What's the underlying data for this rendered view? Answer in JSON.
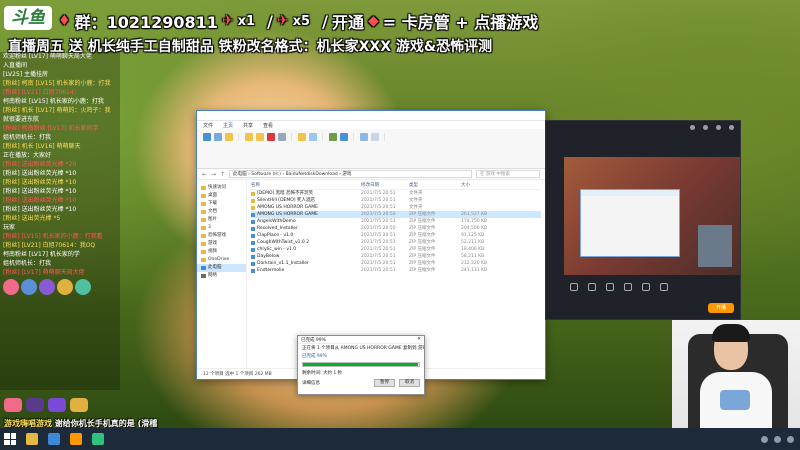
{
  "overlay": {
    "logo": "斗鱼",
    "qq_group_label": "群：1021290811",
    "gift_count_1": "x1",
    "gift_count_2": "x5",
    "open_label": "开通",
    "open_reward": "= 卡房管 + 点播游戏",
    "line2": "直播周五 送  机长纯手工自制甜品    铁粉改名格式：机长家XXX  游戏&恐怖评测"
  },
  "chat": {
    "lines": [
      {
        "text": "欢迎粉丝 [LV17] 萌萌聊天局大佬",
        "style": ""
      },
      {
        "text": "入直播间",
        "style": ""
      },
      {
        "text": "[LV25] 主播挂房",
        "style": ""
      },
      {
        "text": "[粉丝] 柯南 [LV15] 机长家的小鹿：打我",
        "style": "y"
      },
      {
        "text": "[粉丝] [LV21] 白旭70614：",
        "style": "r"
      },
      {
        "text": "柯南粉丝 [LV15] 机长家的小鹿：打我",
        "style": ""
      },
      {
        "text": "[粉丝] 机长 [LV17] 萌萌的：火鸡子：我",
        "style": "y"
      },
      {
        "text": "就很要进东航",
        "style": ""
      },
      {
        "text": "[粉丝] 柯南粉丝 [LV17] 机长家的学",
        "style": "r"
      },
      {
        "text": "姐机师机长：打我",
        "style": ""
      },
      {
        "text": "[粉丝] 机长 [LV16] 萌萌聊天",
        "style": "y"
      },
      {
        "text": "正在播放：大家好",
        "style": ""
      },
      {
        "text": "[粉丝] 送出粉丝荧光棒 *20",
        "style": "r"
      },
      {
        "text": "[粉丝] 送出粉丝荧光棒 *10",
        "style": ""
      },
      {
        "text": "[粉丝] 送出粉丝荧光棒 *10",
        "style": "y"
      },
      {
        "text": "[粉丝] 送出粉丝荧光棒 *10",
        "style": ""
      },
      {
        "text": "[粉丝] 送出粉丝荧光棒 *10",
        "style": "r"
      },
      {
        "text": "[粉丝] 送出粉丝荧光棒 *10",
        "style": ""
      },
      {
        "text": "[粉丝] 送出荧光棒 *5",
        "style": "y"
      },
      {
        "text": "玩家",
        "style": ""
      },
      {
        "text": "[粉丝] [LV15] 机长家的小鹿：打我看",
        "style": "r"
      },
      {
        "text": "[粉丝] [LV21] 白旭70614：我OQ",
        "style": "y"
      },
      {
        "text": "柯南粉丝 [LV17] 机长家的学",
        "style": ""
      },
      {
        "text": "姐机师机长：打我",
        "style": ""
      },
      {
        "text": "[粉丝] [LV17] 萌萌聊天局大佬",
        "style": "r"
      }
    ]
  },
  "explorer": {
    "title": "",
    "tabs": [
      "文件",
      "主页",
      "共享",
      "查看"
    ],
    "address": "此电脑 › Software (H:) › BaiduNetdiskDownload › 游戏",
    "search_placeholder": "在 游戏 中搜索",
    "nav_items": [
      {
        "label": "快速访问",
        "kind": "folder"
      },
      {
        "label": "桌面",
        "kind": "folder"
      },
      {
        "label": "下载",
        "kind": "folder"
      },
      {
        "label": "文档",
        "kind": "folder"
      },
      {
        "label": "图片",
        "kind": "folder"
      },
      {
        "label": "3",
        "kind": "folder"
      },
      {
        "label": "恐怖游戏",
        "kind": "folder"
      },
      {
        "label": "游戏",
        "kind": "folder"
      },
      {
        "label": "视频",
        "kind": "folder"
      },
      {
        "label": "OneDrive",
        "kind": "folder"
      },
      {
        "label": "此电脑",
        "kind": "pc"
      },
      {
        "label": "网络",
        "kind": "net"
      }
    ],
    "columns": [
      "名称",
      "修改日期",
      "类型",
      "大小"
    ],
    "files": [
      {
        "name": "[DEMO] 黑暗 恐怖不开玩笑",
        "date": "2021/7/5 20:51",
        "type": "文件夹",
        "size": "",
        "kind": "folder"
      },
      {
        "name": "SilentHill [DEMO] 死人酒店",
        "date": "2021/7/5 20:51",
        "type": "文件夹",
        "size": "",
        "kind": "folder"
      },
      {
        "name": "AMONG US HORROR GAME",
        "date": "2021/7/5 20:51",
        "type": "文件夹",
        "size": "",
        "kind": "folder"
      },
      {
        "name": "AMONG US HORROR GAME",
        "date": "2021/7/5 20:50",
        "type": "ZIP 压缩文件",
        "size": "263,527 KB",
        "kind": "exe",
        "selected": true
      },
      {
        "name": "AngelsWithDemo",
        "date": "2021/7/5 20:51",
        "type": "ZIP 压缩文件",
        "size": "174,750 KB",
        "kind": "exe"
      },
      {
        "name": "Resolved_Installer",
        "date": "2021/7/5 20:50",
        "type": "ZIP 压缩文件",
        "size": "204,500 KB",
        "kind": "exe"
      },
      {
        "name": "ClapPlace - v1.0",
        "date": "2021/7/5 20:51",
        "type": "ZIP 压缩文件",
        "size": "91,125 KB",
        "kind": "exe"
      },
      {
        "name": "CoughWithTwist_v1.0.2",
        "date": "2021/7/5 20:51",
        "type": "ZIP 压缩文件",
        "size": "52,211 KB",
        "kind": "exe"
      },
      {
        "name": "chrylic_win - v1.0",
        "date": "2021/7/5 20:51",
        "type": "ZIP 压缩文件",
        "size": "18,406 KB",
        "kind": "exe"
      },
      {
        "name": "DayBelow",
        "date": "2021/7/5 20:51",
        "type": "ZIP 压缩文件",
        "size": "58,211 KB",
        "kind": "exe"
      },
      {
        "name": "Darkrain_v1.1_Installer",
        "date": "2021/7/5 20:51",
        "type": "ZIP 压缩文件",
        "size": "212,320 KB",
        "kind": "exe"
      },
      {
        "name": "Endtermolie",
        "date": "2021/7/5 20:51",
        "type": "ZIP 压缩文件",
        "size": "241,131 KB",
        "kind": "exe"
      }
    ],
    "status": "12 个项目     选中 1 个项目  262 MB"
  },
  "copy_dialog": {
    "title": "已完成 99%",
    "line1": "正在将 1 个项目从 AMONG US HORROR GAME 复制到 游戏",
    "line2": "已完成 99%",
    "remaining": "剩余时间: 大约 1 秒",
    "more": "详细信息",
    "pause": "暂停",
    "cancel": "取消",
    "progress": 0.99
  },
  "obs": {
    "tools": [
      "",
      "",
      "",
      "",
      "",
      ""
    ],
    "live_button": "开播"
  },
  "bottom": {
    "ticker_prefix": "游戏嗨唱游戏",
    "ticker": "谢给你机长手机真的是  (滑稽"
  },
  "colors": {
    "accent": "#1f5fb0",
    "progress": "#06b025",
    "obs_live": "#ff9800"
  }
}
